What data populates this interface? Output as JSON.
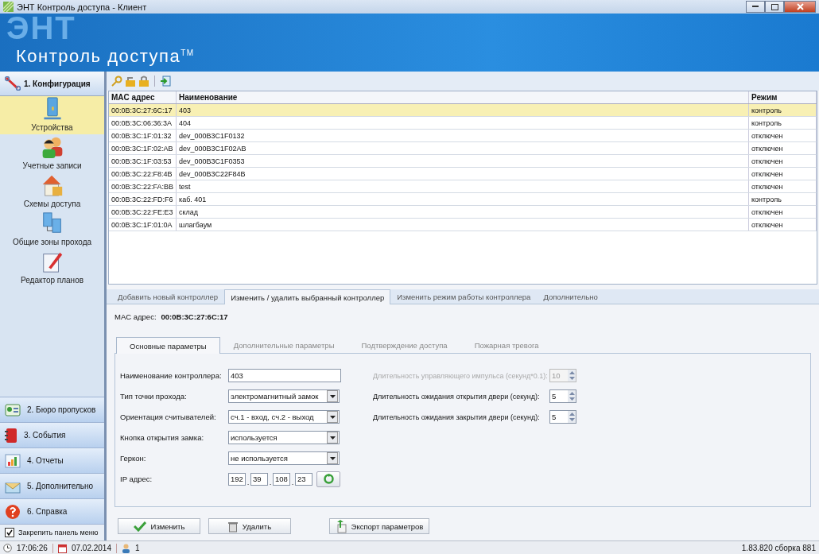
{
  "window": {
    "title": "ЭНТ Контроль доступа - Клиент"
  },
  "banner": {
    "watermark": "ЭНТ",
    "title": "Контроль доступа$^{TM}$"
  },
  "sidebar": {
    "header": "1. Конфигурация",
    "items": [
      {
        "label": "Устройства",
        "selected": true,
        "kind": "device"
      },
      {
        "label": "Учетные записи",
        "selected": false,
        "kind": "users"
      },
      {
        "label": "Схемы доступа",
        "selected": false,
        "kind": "house"
      },
      {
        "label": "Общие зоны прохода",
        "selected": false,
        "kind": "zones"
      },
      {
        "label": "Редактор планов",
        "selected": false,
        "kind": "editor"
      }
    ],
    "sections": [
      {
        "label": "2. Бюро пропусков",
        "kind": "card"
      },
      {
        "label": "3. События",
        "kind": "book"
      },
      {
        "label": "4. Отчеты",
        "kind": "chart"
      },
      {
        "label": "5. Дополнительно",
        "kind": "mail"
      },
      {
        "label": "6. Справка",
        "kind": "help"
      }
    ],
    "pin": {
      "label": "Закрепить панель меню",
      "checked": true
    }
  },
  "table": {
    "columns": [
      "MAC адрес",
      "Наименование",
      "Режим"
    ],
    "rows": [
      {
        "cells": [
          "00:0B:3C:27:6C:17",
          "403",
          "контроль"
        ],
        "selected": true
      },
      {
        "cells": [
          "00:0B:3C:06:36:3A",
          "404",
          "контроль"
        ],
        "selected": false
      },
      {
        "cells": [
          "00:0B:3C:1F:01:32",
          "dev_000B3C1F0132",
          "отключен"
        ],
        "selected": false
      },
      {
        "cells": [
          "00:0B:3C:1F:02:AB",
          "dev_000B3C1F02AB",
          "отключен"
        ],
        "selected": false
      },
      {
        "cells": [
          "00:0B:3C:1F:03:53",
          "dev_000B3C1F0353",
          "отключен"
        ],
        "selected": false
      },
      {
        "cells": [
          "00:0B:3C:22:F8:4B",
          "dev_000B3C22F84B",
          "отключен"
        ],
        "selected": false
      },
      {
        "cells": [
          "00:0B:3C:22:FA:BB",
          "test",
          "отключен"
        ],
        "selected": false
      },
      {
        "cells": [
          "00:0B:3C:22:FD:F6",
          "каб. 401",
          "контроль"
        ],
        "selected": false
      },
      {
        "cells": [
          "00:0B:3C:22:FE:E3",
          "склад",
          "отключен"
        ],
        "selected": false
      },
      {
        "cells": [
          "00:0B:3C:1F:01:0A",
          "шлагбаум",
          "отключен"
        ],
        "selected": false
      }
    ]
  },
  "tabs": [
    {
      "label": "Добавить новый контроллер",
      "selected": false
    },
    {
      "label": "Изменить / удалить выбранный контроллер",
      "selected": true
    },
    {
      "label": "Изменить режим работы контроллера",
      "selected": false
    },
    {
      "label": "Дополнительно",
      "selected": false
    }
  ],
  "mac": {
    "label": "MAC адрес:",
    "value": "00:0B:3C:27:6C:17"
  },
  "subtabs": [
    {
      "label": "Основные параметры",
      "selected": true
    },
    {
      "label": "Дополнительные параметры",
      "selected": false
    },
    {
      "label": "Подтверждение доступа",
      "selected": false
    },
    {
      "label": "Пожарная тревога",
      "selected": false
    }
  ],
  "fields": [
    {
      "label": "Наименование контроллера:",
      "kind": "text",
      "value": "403"
    },
    {
      "label": "Тип точки прохода:",
      "kind": "select",
      "value": "электромагнитный замок"
    },
    {
      "label": "Ориентация считывателей:",
      "kind": "select",
      "value": "сч.1 - вход, сч.2 - выход"
    },
    {
      "label": "Кнопка открытия замка:",
      "kind": "select",
      "value": "используется"
    },
    {
      "label": "Геркон:",
      "kind": "select",
      "value": "не используется"
    },
    {
      "label": "IP адрес:",
      "kind": "ip",
      "octets": [
        "192",
        "39",
        "108",
        "23"
      ],
      "separator": "."
    }
  ],
  "spinners": [
    {
      "label": "Длительность управляющего импульса (секунд*0.1):",
      "value": "10",
      "disabled": true
    },
    {
      "label": "Длительность ожидания открытия двери (секунд):",
      "value": "5",
      "disabled": false
    },
    {
      "label": "Длительность ожидания закрытия двери (секунд):",
      "value": "5",
      "disabled": false
    }
  ],
  "buttons": [
    {
      "label": "Изменить",
      "kind": "check"
    },
    {
      "label": "Удалить",
      "kind": "trash"
    },
    {
      "label": "Экспорт параметров",
      "kind": "export"
    }
  ],
  "status_bar": {
    "time": "17:06:26",
    "date": "07.02.2014",
    "users": "1",
    "version": "1.83.820 сборка 881"
  }
}
